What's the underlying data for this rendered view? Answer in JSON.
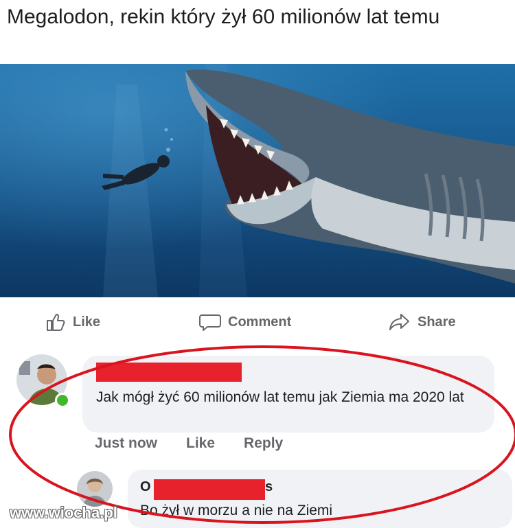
{
  "post": {
    "title": "Megalodon, rekin który żył 60 milionów lat temu",
    "image_description_icon": "shark-photo"
  },
  "actions": {
    "like": "Like",
    "comment": "Comment",
    "share": "Share"
  },
  "comments": [
    {
      "author_redacted": true,
      "text": "Jak mógł żyć 60 milionów lat temu jak Ziemia ma 2020 lat",
      "time": "Just now",
      "like": "Like",
      "reply": "Reply",
      "online": true
    },
    {
      "author_prefix": "O",
      "author_suffix": "s",
      "author_redacted": true,
      "text": "Bo żył w morzu a nie na Ziemi"
    }
  ],
  "watermark": "www.wiocha.pl",
  "colors": {
    "redaction": "#e8222c",
    "highlight_ring": "#d9141e",
    "bubble": "#f0f2f5",
    "meta_text": "#65676b",
    "online": "#42b72a"
  }
}
